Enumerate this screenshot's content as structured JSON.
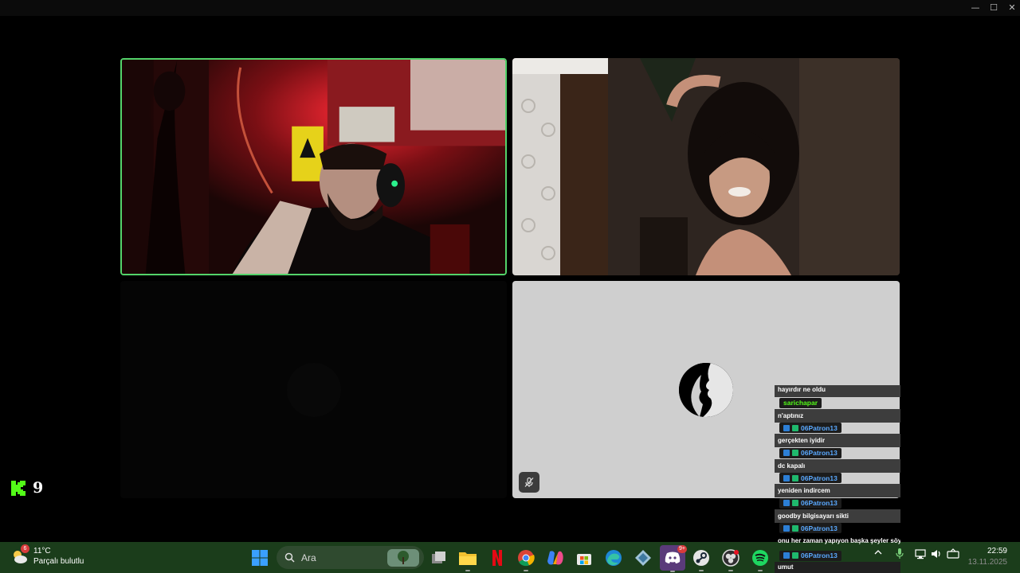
{
  "window": {
    "controls": {
      "minimize": "—",
      "maximize": "☐",
      "close": "✕"
    }
  },
  "tiles": [
    {
      "id": "participant-1",
      "active_speaker": true
    },
    {
      "id": "participant-2",
      "active_speaker": false
    },
    {
      "id": "participant-3",
      "active_speaker": false
    },
    {
      "id": "participant-4",
      "active_speaker": false,
      "muted": true
    }
  ],
  "kick": {
    "viewer_count": "9",
    "accent": "#53fc18"
  },
  "chat": {
    "first_message": "hayırdır ne oldu",
    "messages": [
      {
        "user": "sarichapar",
        "user_color": "#53fc18",
        "badges": false,
        "text": "n'aptınız"
      },
      {
        "user": "06Patron13",
        "user_color": "#5aa9ff",
        "badges": true,
        "text": "gerçekten iyidir"
      },
      {
        "user": "06Patron13",
        "user_color": "#5aa9ff",
        "badges": true,
        "text": "dc kapalı"
      },
      {
        "user": "06Patron13",
        "user_color": "#5aa9ff",
        "badges": true,
        "text": "yeniden indircem"
      },
      {
        "user": "06Patron13",
        "user_color": "#5aa9ff",
        "badges": true,
        "text": "goodby bilgisayarı sikti"
      },
      {
        "user": "06Patron13",
        "user_color": "#5aa9ff",
        "badges": true,
        "text": "onu her zaman yapıyon başka şeyler söyle"
      },
      {
        "user": "06Patron13",
        "user_color": "#5aa9ff",
        "badges": true,
        "text": "umut"
      }
    ]
  },
  "taskbar": {
    "weather": {
      "temp": "11°C",
      "condition": "Parçalı bulutlu",
      "badge": "6"
    },
    "search_placeholder": "Ara",
    "apps": [
      {
        "name": "start-icon"
      },
      {
        "name": "task-view-icon"
      },
      {
        "name": "file-explorer-icon"
      },
      {
        "name": "netflix-icon"
      },
      {
        "name": "chrome-icon"
      },
      {
        "name": "copilot-icon"
      },
      {
        "name": "microsoft-store-icon"
      },
      {
        "name": "edge-icon"
      },
      {
        "name": "app-icon"
      },
      {
        "name": "discord-icon",
        "badge": "9+"
      },
      {
        "name": "steam-icon"
      },
      {
        "name": "obs-icon"
      },
      {
        "name": "spotify-icon"
      }
    ],
    "clock": {
      "time": "22:59",
      "date": "13.11.2025"
    }
  }
}
